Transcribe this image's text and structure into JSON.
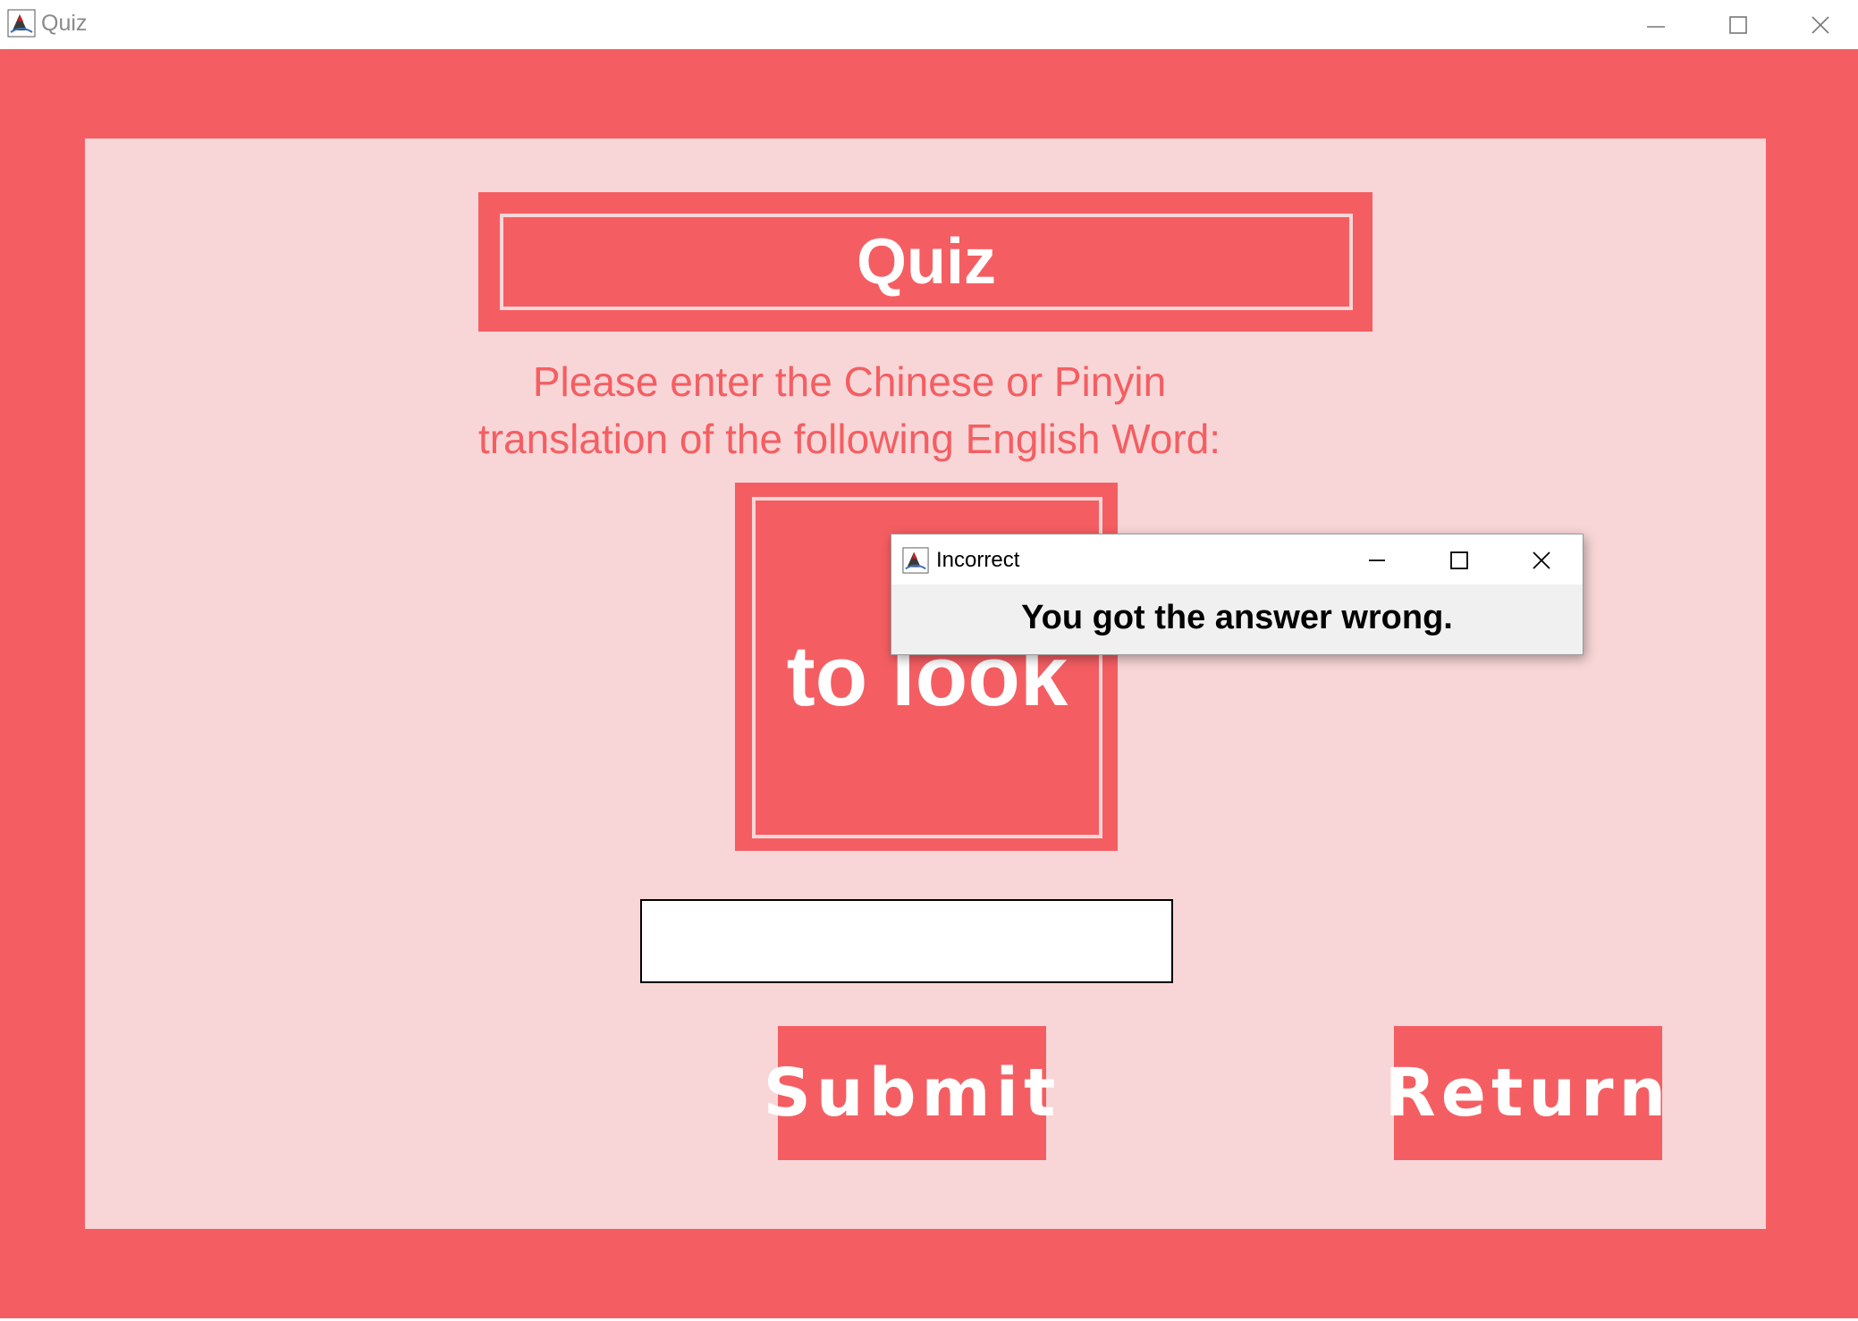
{
  "window": {
    "title": "Quiz",
    "icon": "java-app-icon",
    "controls": [
      "minimize-icon",
      "maximize-icon",
      "close-icon"
    ]
  },
  "quiz": {
    "heading": "Quiz",
    "instruction_line1": "Please enter the Chinese or Pinyin",
    "instruction_line2": "translation of the following English Word:",
    "word": "to look",
    "answer_value": "",
    "submit_label": "Submit",
    "return_label": "Return"
  },
  "dialog": {
    "title": "Incorrect",
    "icon": "java-app-icon",
    "message": "You got the answer wrong."
  },
  "colors": {
    "accent_red": "#f45e62",
    "panel_pink": "#f8d6d7",
    "dialog_bg": "#f0f0f0"
  }
}
